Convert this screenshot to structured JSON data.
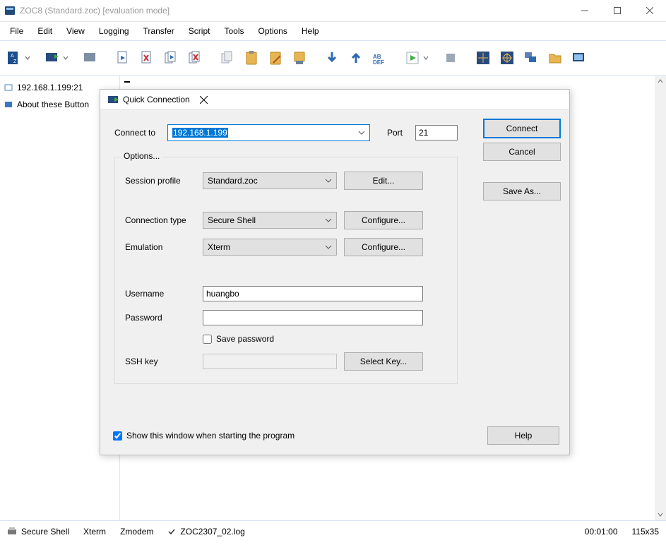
{
  "window": {
    "title": "ZOC8 (Standard.zoc) [evaluation mode]"
  },
  "menu": [
    "File",
    "Edit",
    "View",
    "Logging",
    "Transfer",
    "Script",
    "Tools",
    "Options",
    "Help"
  ],
  "tabs": [
    {
      "label": "192.168.1.199:21"
    },
    {
      "label": "About these Button"
    }
  ],
  "status": {
    "conn": "Secure Shell",
    "emul": "Xterm",
    "xfer": "Zmodem",
    "logfile": "ZOC2307_02.log",
    "time": "00:01:00",
    "size": "115x35"
  },
  "dialog": {
    "title": "Quick Connection",
    "connectTo_label": "Connect to",
    "connectTo_value": "192.168.1.199",
    "port_label": "Port",
    "port_value": "21",
    "options_legend": "Options...",
    "sessionProfile_label": "Session profile",
    "sessionProfile_value": "Standard.zoc",
    "connectionType_label": "Connection type",
    "connectionType_value": "Secure Shell",
    "emulation_label": "Emulation",
    "emulation_value": "Xterm",
    "username_label": "Username",
    "username_value": "huangbo",
    "password_label": "Password",
    "password_value": "",
    "savePassword_label": "Save password",
    "sshkey_label": "SSH key",
    "edit_btn": "Edit...",
    "configure_btn": "Configure...",
    "selectKey_btn": "Select Key...",
    "connect_btn": "Connect",
    "cancel_btn": "Cancel",
    "saveAs_btn": "Save As...",
    "help_btn": "Help",
    "showStartup_label": "Show this window when starting the program"
  }
}
